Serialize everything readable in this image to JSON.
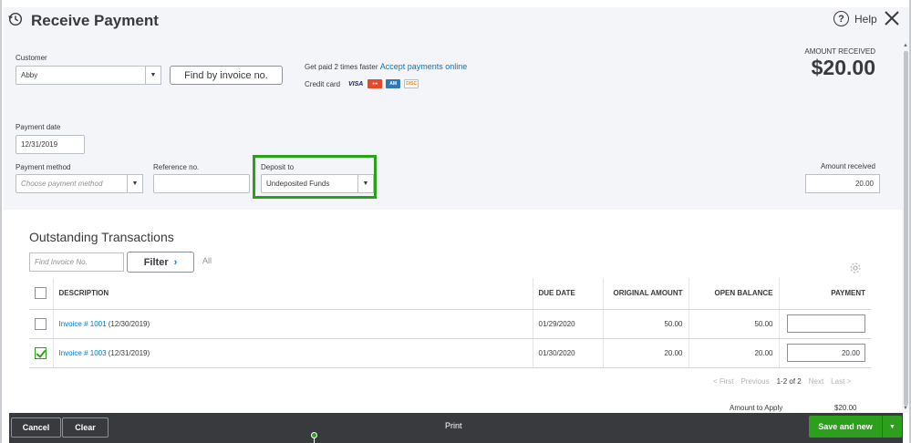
{
  "header": {
    "title": "Receive Payment",
    "help_label": "Help"
  },
  "customer": {
    "label": "Customer",
    "value": "Abby",
    "find_button": "Find by invoice no."
  },
  "promo": {
    "text": "Get paid 2 times faster",
    "link": "Accept payments online",
    "credit_card_label": "Credit card",
    "cards": [
      "VISA",
      "mastercard",
      "amex",
      "discover"
    ]
  },
  "amount_header": {
    "label": "AMOUNT RECEIVED",
    "value": "$20.00"
  },
  "payment_date": {
    "label": "Payment date",
    "value": "12/31/2019"
  },
  "payment_method": {
    "label": "Payment method",
    "placeholder": "Choose payment method"
  },
  "reference": {
    "label": "Reference no.",
    "value": ""
  },
  "deposit": {
    "label": "Deposit to",
    "value": "Undeposited Funds",
    "highlight_color": "#2ca01c"
  },
  "amount_received": {
    "label": "Amount received",
    "value": "20.00"
  },
  "outstanding": {
    "title": "Outstanding Transactions",
    "search_placeholder": "Find Invoice No.",
    "filter_label": "Filter",
    "all_label": "All",
    "columns": [
      "DESCRIPTION",
      "DUE DATE",
      "ORIGINAL AMOUNT",
      "OPEN BALANCE",
      "PAYMENT"
    ],
    "rows": [
      {
        "checked": false,
        "invoice": "Invoice # 1001",
        "date": " (12/30/2019)",
        "due": "01/29/2020",
        "original": "50.00",
        "open": "50.00",
        "payment": ""
      },
      {
        "checked": true,
        "invoice": "Invoice # 1003",
        "date": " (12/31/2019)",
        "due": "01/30/2020",
        "original": "20.00",
        "open": "20.00",
        "payment": "20.00"
      }
    ]
  },
  "pager": {
    "first": "< First",
    "previous": "Previous",
    "range": "1-2 of 2",
    "next": "Next",
    "last": "Last >"
  },
  "apply": {
    "label": "Amount to Apply",
    "value": "$20.00"
  },
  "footer": {
    "cancel": "Cancel",
    "clear": "Clear",
    "print": "Print",
    "save_new": "Save and new"
  },
  "colors": {
    "accent_green": "#2ca01c",
    "link_blue": "#0077c5",
    "footer_dark": "#393a3d"
  }
}
